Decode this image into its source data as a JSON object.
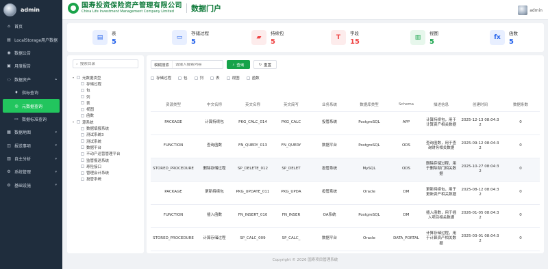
{
  "sidebar": {
    "username": "admin",
    "items": [
      {
        "label": "首页",
        "icon": "home-icon",
        "glyph": "⌂"
      },
      {
        "label": "LocalStorage用户数据",
        "icon": "storage-icon",
        "glyph": "▤"
      },
      {
        "label": "数据公告",
        "icon": "notice-icon",
        "glyph": "◉"
      },
      {
        "label": "月度报告",
        "icon": "report-icon",
        "glyph": "▣"
      },
      {
        "label": "数据资产",
        "icon": "asset-icon",
        "glyph": "◌",
        "chevron": "▴"
      },
      {
        "label": "指标查询",
        "icon": "flame-icon",
        "glyph": "♦"
      },
      {
        "label": "元数据查询",
        "icon": "location-icon",
        "glyph": "◎"
      },
      {
        "label": "数据标准查询",
        "icon": "standard-icon",
        "glyph": "▭"
      },
      {
        "label": "数据地图",
        "icon": "map-icon",
        "glyph": "▦",
        "chevron": "▾"
      },
      {
        "label": "报送事项",
        "icon": "submit-icon",
        "glyph": "◫",
        "chevron": "▾"
      },
      {
        "label": "自主分析",
        "icon": "analysis-icon",
        "glyph": "▥",
        "chevron": "▾"
      },
      {
        "label": "系统管理",
        "icon": "system-icon",
        "glyph": "⚙",
        "chevron": "▾"
      },
      {
        "label": "基础设施",
        "icon": "infra-icon",
        "glyph": "⚙",
        "chevron": "▾"
      }
    ]
  },
  "header": {
    "logo_cn": "国寿投资保险资产管理有限公司",
    "logo_en": "China Life Investment Management Company Limited",
    "portal_title": "数据门户",
    "username": "admin"
  },
  "stats": [
    {
      "label": "表",
      "value": "5",
      "glyph": "▤",
      "color": "#2563eb",
      "bg": "#e8efff",
      "icon": "table-icon"
    },
    {
      "label": "存储过程",
      "value": "5",
      "glyph": "▭",
      "color": "#2563eb",
      "bg": "#e8efff",
      "icon": "procedure-icon"
    },
    {
      "label": "持续包",
      "value": "5",
      "glyph": "▰",
      "color": "#ef4444",
      "bg": "#fdecec",
      "icon": "package-icon"
    },
    {
      "label": "字段",
      "value": "15",
      "glyph": "T",
      "color": "#ef4444",
      "bg": "#fdecec",
      "icon": "field-icon"
    },
    {
      "label": "视图",
      "value": "5",
      "glyph": "▥",
      "color": "#16a34a",
      "bg": "#e7f7ec",
      "icon": "view-icon"
    },
    {
      "label": "函数",
      "value": "5",
      "glyph": "fx",
      "color": "#2563eb",
      "bg": "#e8efff",
      "icon": "function-icon"
    }
  ],
  "tree": {
    "placeholder": "搜索目录",
    "groups": [
      {
        "label": "元数据类型",
        "children": [
          "存储过程",
          "包",
          "列",
          "表",
          "视图",
          "函数"
        ]
      },
      {
        "label": "源系统",
        "children": [
          "数据填报系统",
          "测试系统3",
          "测试系统",
          "数据平台",
          "不动产运营管理平台",
          "监管报送系统",
          "寿险接口",
          "管理会计系统",
          "投管系统"
        ]
      }
    ]
  },
  "filter": {
    "label": "模糊搜索",
    "placeholder": "请输入搜索内容",
    "search_label": "查询",
    "reset_label": "重置",
    "checkboxes": [
      "存储过程",
      "包",
      "列",
      "表",
      "视图",
      "函数"
    ]
  },
  "table": {
    "columns": [
      "资源类型",
      "中文名称",
      "英文名称",
      "英文简写",
      "业务系统",
      "数据库类型",
      "Schema",
      "描述信息",
      "创建时间",
      "数据条数"
    ],
    "rows": [
      [
        "PACKAGE",
        "计算持续包",
        "PKG_CALC_014",
        "PKG_CALC",
        "投管系统",
        "PostgreSQL",
        "APP",
        "计算持续包，用于计算资产相关数据",
        "2025-12-13 08:04:32",
        "0"
      ],
      [
        "FUNCTION",
        "查询函数",
        "FN_QUERY_013",
        "FN_QUERY",
        "数据平台",
        "PostgreSQL",
        "ODS",
        "查询函数，用于查询财务相关数据",
        "2025-09-12 08:04:32",
        "0"
      ],
      [
        "STORED_PROCEDURE",
        "删除存储过程",
        "SP_DELETE_012",
        "SP_DELET",
        "投管系统",
        "MySQL",
        "ODS",
        "删除存储过程，用于删除部门相关数据",
        "2025-10-27 08:04:32",
        "0"
      ],
      [
        "PACKAGE",
        "更新持续包",
        "PKG_UPDATE_011",
        "PKG_UPDA",
        "投管系统",
        "Oracle",
        "DM",
        "更新持续包，用于更新资产相关数据",
        "2025-08-12 08:04:32",
        "0"
      ],
      [
        "FUNCTION",
        "插入函数",
        "FN_INSERT_010",
        "FN_INSER",
        "OA系统",
        "PostgreSQL",
        "DM",
        "插入函数，用于插入项目相关数据",
        "2026-01-05 08:04:32",
        "0"
      ],
      [
        "STORED_PROCEDURE",
        "计算存储过程",
        "SP_CALC_009",
        "SP_CALC_",
        "数据平台",
        "Oracle",
        "DATA_PORTAL",
        "计算存储过程，用于计算资产相关数据",
        "2025-03-01 08:04:32",
        "0"
      ]
    ]
  },
  "footer": "Copyright © 2026 国寿项目管理系统"
}
